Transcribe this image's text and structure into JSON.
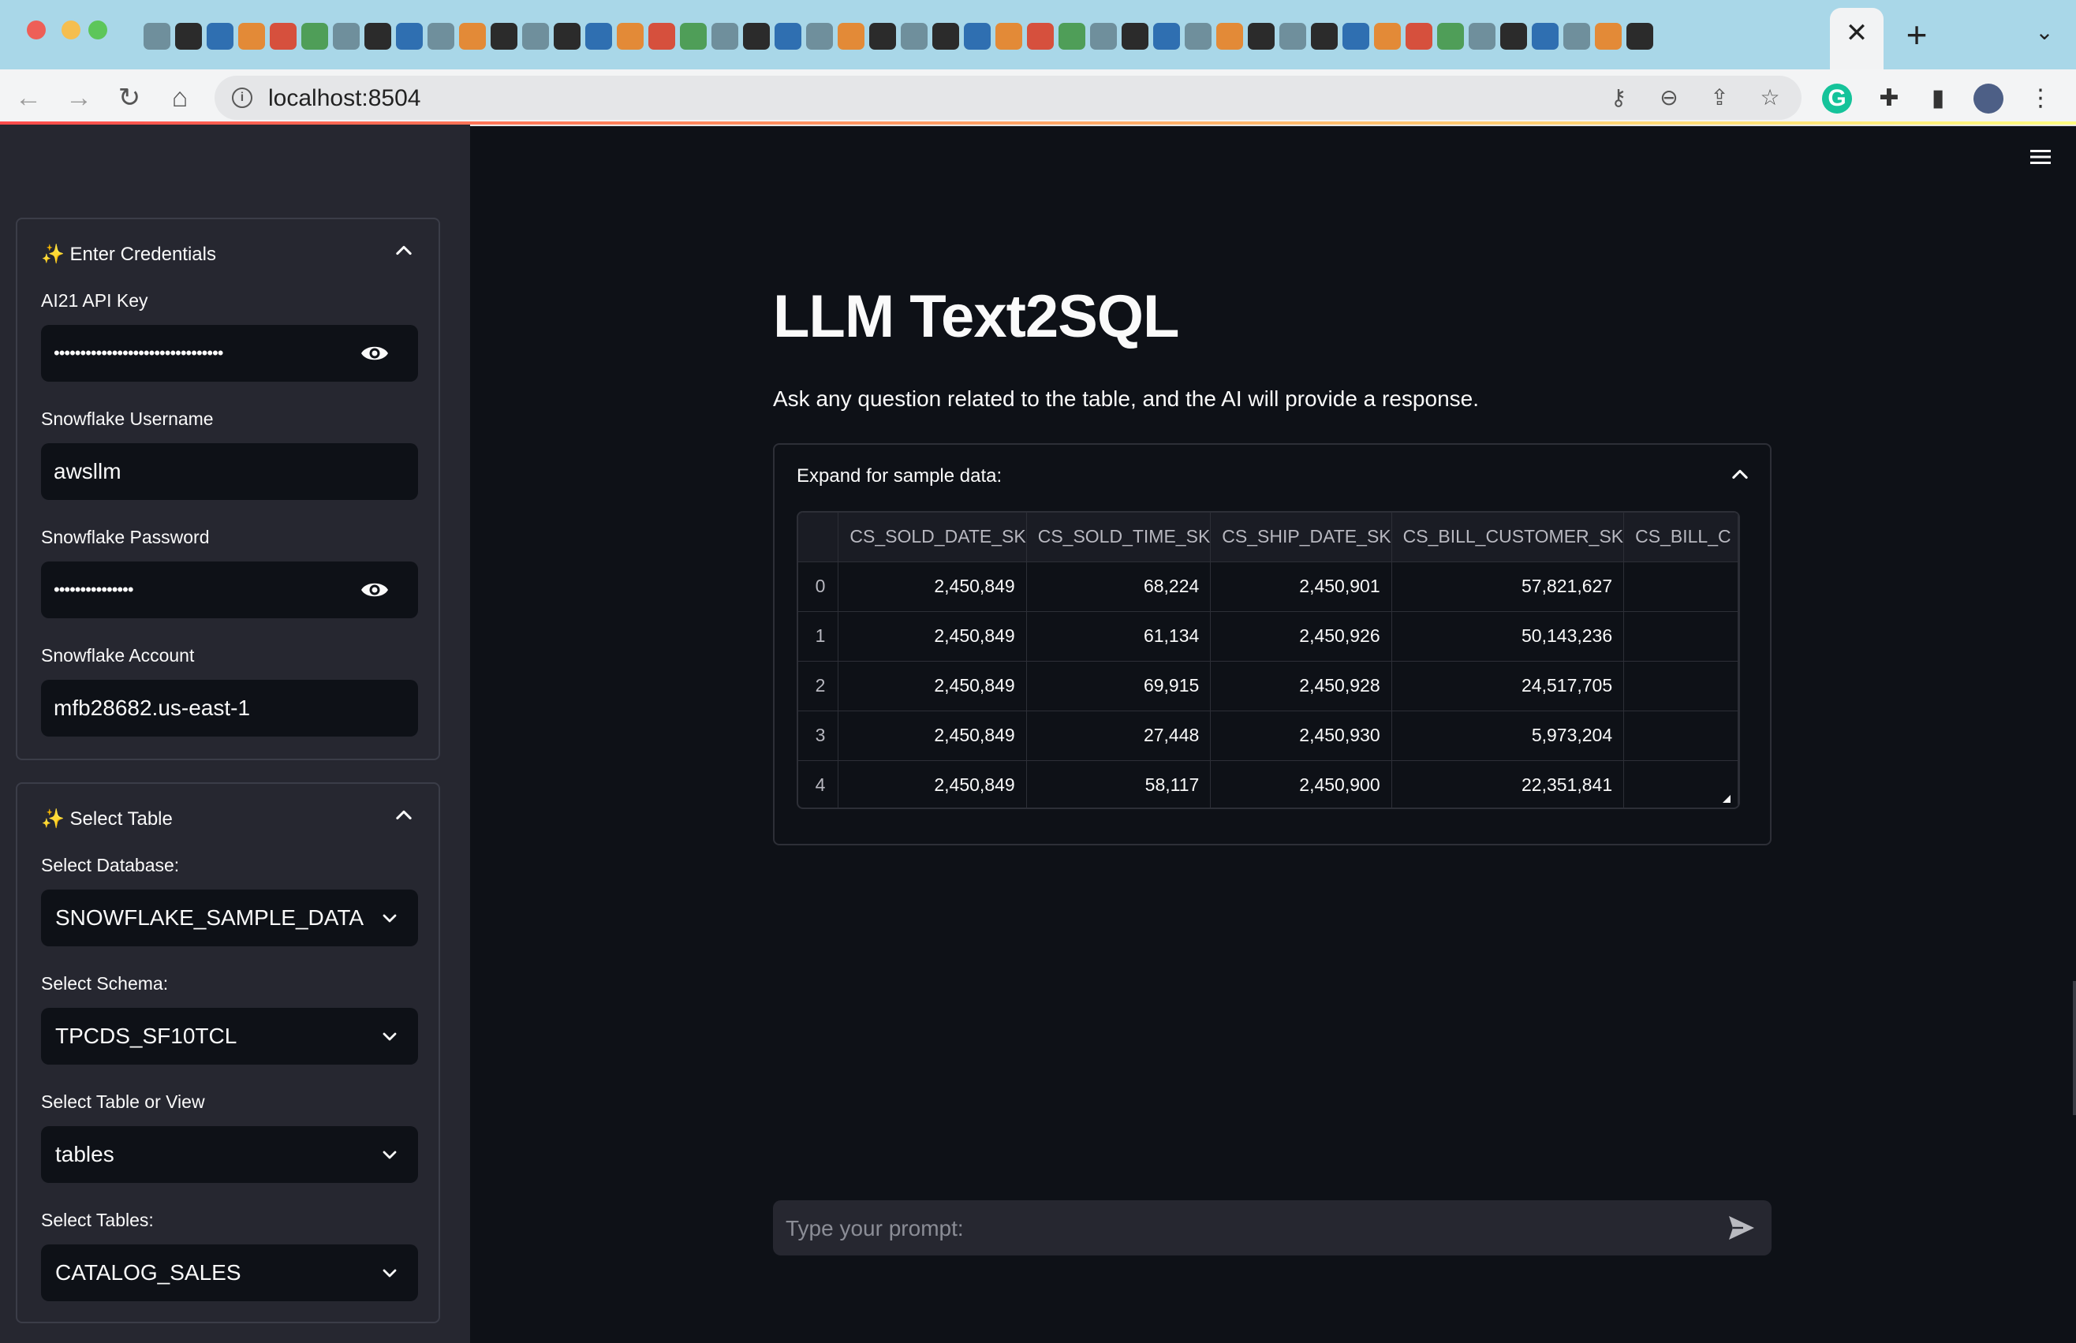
{
  "browser": {
    "url": "localhost:8504",
    "active_tab_close": "✕",
    "new_tab": "+",
    "tab_search": "⌄"
  },
  "sidebar": {
    "credentials": {
      "title": "✨ Enter Credentials",
      "fields": [
        {
          "label": "AI21 API Key",
          "value": "••••••••••••••••••••••••••••••••",
          "type": "password"
        },
        {
          "label": "Snowflake Username",
          "value": "awsllm",
          "type": "text"
        },
        {
          "label": "Snowflake Password",
          "value": "•••••••••••••••",
          "type": "password"
        },
        {
          "label": "Snowflake Account",
          "value": "mfb28682.us-east-1",
          "type": "text"
        }
      ]
    },
    "table_select": {
      "title": "✨ Select Table",
      "selects": [
        {
          "label": "Select Database:",
          "value": "SNOWFLAKE_SAMPLE_DATA"
        },
        {
          "label": "Select Schema:",
          "value": "TPCDS_SF10TCL"
        },
        {
          "label": "Select Table or View",
          "value": "tables"
        },
        {
          "label": "Select Tables:",
          "value": "CATALOG_SALES"
        }
      ]
    }
  },
  "main": {
    "title": "LLM Text2SQL",
    "subtitle": "Ask any question related to the table, and the AI will provide a response.",
    "sample_expander": {
      "title": "Expand for sample data:",
      "columns": [
        "",
        "CS_SOLD_DATE_SK",
        "CS_SOLD_TIME_SK",
        "CS_SHIP_DATE_SK",
        "CS_BILL_CUSTOMER_SK",
        "CS_BILL_C"
      ],
      "rows": [
        [
          "0",
          "2,450,849",
          "68,224",
          "2,450,901",
          "57,821,627",
          ""
        ],
        [
          "1",
          "2,450,849",
          "61,134",
          "2,450,926",
          "50,143,236",
          ""
        ],
        [
          "2",
          "2,450,849",
          "69,915",
          "2,450,928",
          "24,517,705",
          ""
        ],
        [
          "3",
          "2,450,849",
          "27,448",
          "2,450,930",
          "5,973,204",
          ""
        ],
        [
          "4",
          "2,450,849",
          "58,117",
          "2,450,900",
          "22,351,841",
          ""
        ]
      ]
    },
    "chat": {
      "placeholder": "Type your prompt:"
    }
  },
  "colors": {
    "background": "#0e1117",
    "sidebar": "#262730",
    "text": "#fafafa",
    "accent_red": "#ff4b4b",
    "browser_tabstrip": "#a9d7e8"
  }
}
